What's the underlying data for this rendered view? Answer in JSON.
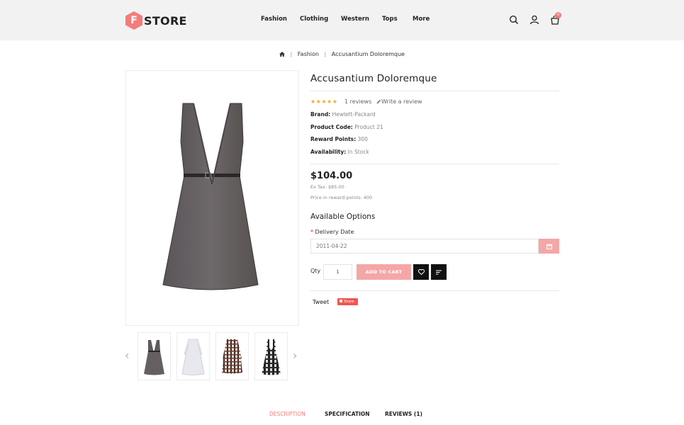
{
  "header": {
    "logo_letter": "F",
    "logo_text": "STORE",
    "nav": [
      "Fashion",
      "Clothing",
      "Western",
      "Tops",
      "More"
    ],
    "cart_count": "0"
  },
  "breadcrumb": {
    "home_icon": "home-icon",
    "items": [
      "Fashion",
      "Accusantium Doloremque"
    ]
  },
  "product": {
    "title": "Accusantium Doloremque",
    "stars": "★★★★★",
    "reviews": "1 reviews",
    "write_review": "Write a review",
    "specs": [
      {
        "label": "Brand:",
        "value": "Hewlett-Packard"
      },
      {
        "label": "Product Code:",
        "value": "Product 21"
      },
      {
        "label": "Reward Points:",
        "value": "300"
      },
      {
        "label": "Availability:",
        "value": "In Stock"
      }
    ],
    "price": "$104.00",
    "ex_tax": "Ex Tax: $85.00",
    "reward_price": "Price in reward points: 400"
  },
  "options": {
    "title": "Available Options",
    "delivery_label": "Delivery Date",
    "required_mark": "*",
    "delivery_value": "2011-04-22"
  },
  "cart": {
    "qty_label": "Qty",
    "qty_value": "1",
    "add_to_cart": "ADD TO CART"
  },
  "social": {
    "tweet": "Tweet",
    "share": "Share"
  },
  "tabs": [
    "DESCRIPTION",
    "SPECIFICATION",
    "REVIEWS (1)"
  ],
  "colors": {
    "accent": "#f47c7c",
    "button_pink": "#f5a6a6",
    "star": "#f4a62a",
    "header_bg": "#f2f2f2"
  }
}
